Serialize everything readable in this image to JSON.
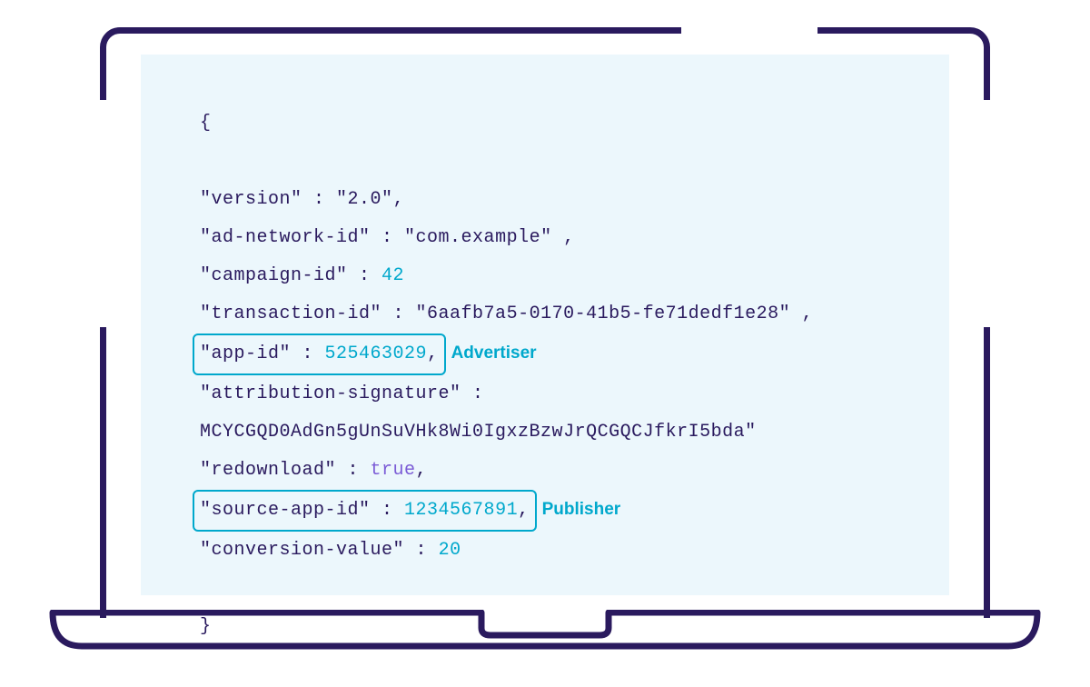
{
  "json_payload": {
    "open_brace": "{",
    "close_brace": "}",
    "lines": {
      "version": {
        "key": "\"version\"",
        "colon": " : ",
        "val": "\"2.0\"",
        "trail": ","
      },
      "ad_network_id": {
        "key": "\"ad-network-id\"",
        "colon": " : ",
        "val": "\"com.example\"",
        "trail": " ,"
      },
      "campaign_id": {
        "key": "\"campaign-id\"",
        "colon": " : ",
        "val": "42"
      },
      "transaction_id": {
        "key": "\"transaction-id\"",
        "colon": "  :  ",
        "val": "\"6aafb7a5-0170-41b5-fe71dedf1e28\"",
        "trail": " ,"
      },
      "app_id": {
        "key": "\"app-id\"",
        "colon": "  : ",
        "val": "525463029",
        "trail": ","
      },
      "attribution_signature": {
        "key": "\"attribution-signature\"",
        "colon": " :"
      },
      "attribution_signature_value": {
        "val": "MCYCGQD0AdGn5gUnSuVHk8Wi0IgxzBzwJrQCGQCJfkrI5bda\""
      },
      "redownload": {
        "key": "\"redownload\"",
        "colon": " : ",
        "val": "true",
        "trail": ","
      },
      "source_app_id": {
        "key": "\"source-app-id\"",
        "colon": " : ",
        "val": "1234567891",
        "trail": ","
      },
      "conversion_value": {
        "key": "\"conversion-value\"",
        "colon": " : ",
        "val": "20"
      }
    }
  },
  "annotations": {
    "app_id": "Advertiser",
    "source_app_id": "Publisher"
  },
  "colors": {
    "frame": "#2a1a5e",
    "panel_bg": "#ecf7fc",
    "text": "#2a1a5e",
    "number": "#00a8cc",
    "boolean": "#7b5cd6",
    "highlight": "#00a8cc"
  }
}
